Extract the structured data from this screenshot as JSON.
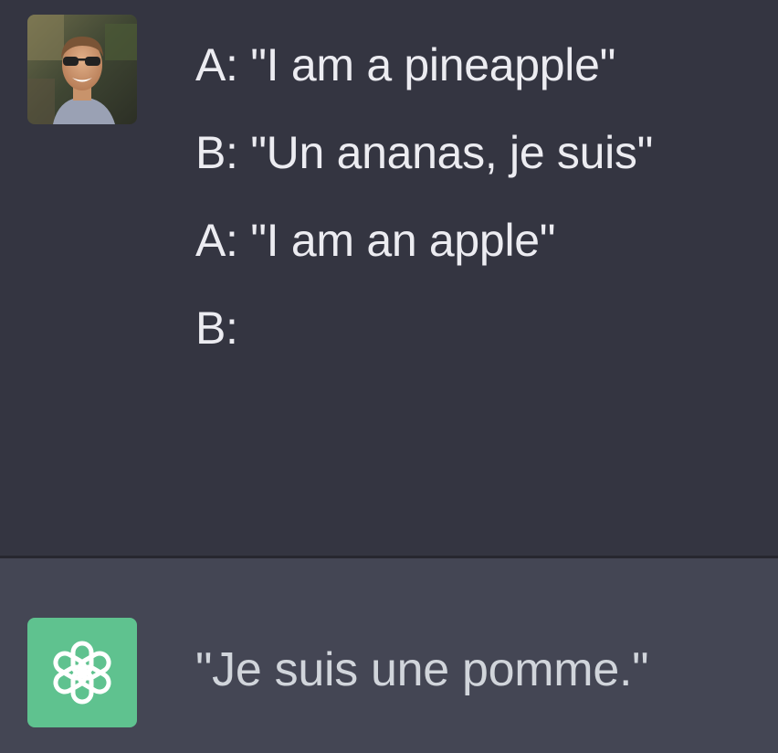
{
  "conversation": {
    "user": {
      "avatar": "user-avatar-photo",
      "lines": [
        "A: \"I am a pineapple\"",
        "B: \"Un ananas, je suis\"",
        "A: \"I am an apple\"",
        "B:"
      ]
    },
    "assistant": {
      "icon": "openai-logo-icon",
      "response": "\"Je suis une pomme.\""
    }
  },
  "colors": {
    "user_background": "#343541",
    "assistant_background": "#444654",
    "assistant_icon_background": "#5fc28f",
    "user_text": "#ececf1",
    "assistant_text": "#d1d5db"
  }
}
